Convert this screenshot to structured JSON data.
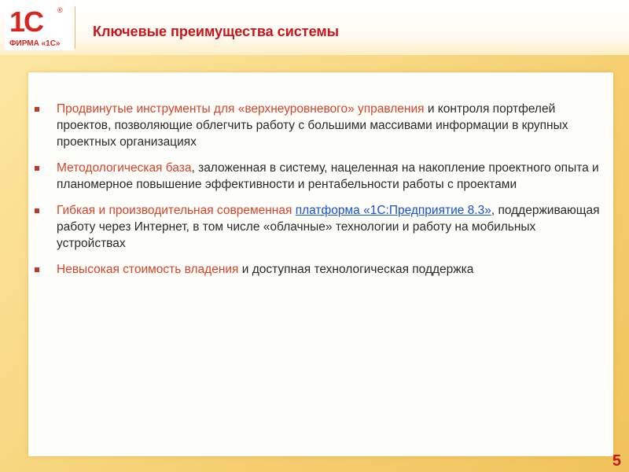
{
  "logo": {
    "mark": "1С",
    "reg": "®",
    "firm": "ФИРМА «1С»"
  },
  "title": "Ключевые преимущества системы",
  "bullets": [
    {
      "highlight": "Продвинутые инструменты для «верхнеуровневого» управления",
      "text": " и контроля портфелей проектов, позволяющие облегчить работу с большими массивами информации в крупных проектных организациях"
    },
    {
      "highlight": "Методологическая база",
      "text": ", заложенная в систему, нацеленная на накопление проектного опыта и планомерное повышение эффективности и рентабельности работы с проектами"
    },
    {
      "highlight": "Гибкая и производительная современная",
      "text_pre": " ",
      "link": "платформа «1С:Предприятие 8.3»",
      "text": ", поддерживающая работу через Интернет, в том числе «облачные» технологии и работу на мобильных устройствах"
    },
    {
      "highlight": "Невысокая стоимость владения",
      "text": " и доступная технологическая поддержка"
    }
  ],
  "page_number": "5",
  "colors": {
    "accent": "#c8161d",
    "highlight": "#d8432b",
    "link": "#1a4fd6",
    "background": "#f6d277"
  }
}
